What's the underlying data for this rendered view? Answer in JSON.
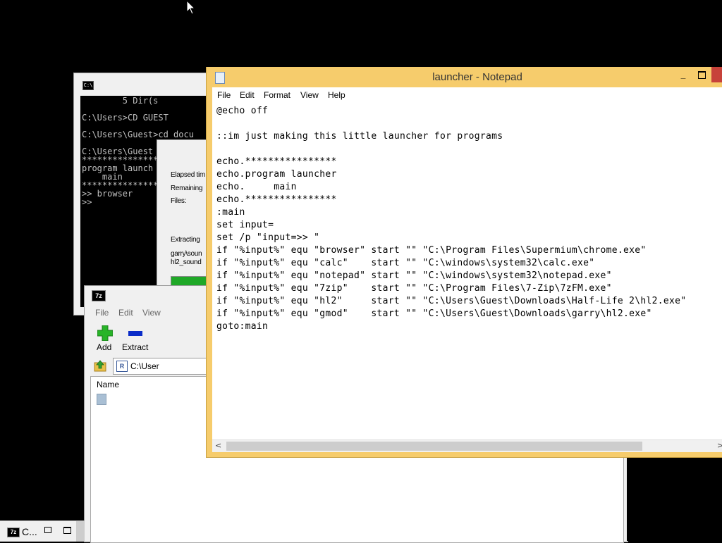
{
  "cmd": {
    "icon_text": "C:\\",
    "lines": [
      "        5 Dir(s",
      "C:\\Users>CD GUEST",
      "C:\\Users\\Guest>cd docu",
      "C:\\Users\\Guest",
      "*****************",
      "program launch",
      "    main",
      "*****************",
      ">> browser",
      ">>"
    ]
  },
  "extract": {
    "elapsed_label": "Elapsed tim",
    "remaining_label": "Remaining",
    "files_label": "Files:",
    "extracting_label": "Extracting",
    "file_line_1": "garry\\soun",
    "file_line_2": "hl2_sound",
    "progress_percent": 100,
    "bar_color": "#1fa827"
  },
  "sevenzip": {
    "icon_text": "7z",
    "menu": [
      "File",
      "Edit",
      "View"
    ],
    "toolbar": {
      "add_label": "Add",
      "extract_label": "Extract"
    },
    "path_value": "C:\\User",
    "column_name": "Name"
  },
  "notepad": {
    "title": "launcher - Notepad",
    "minimize_glyph": "_",
    "menu": [
      "File",
      "Edit",
      "Format",
      "View",
      "Help"
    ],
    "lines": [
      "@echo off",
      "",
      "::im just making this little launcher for programs",
      "",
      "echo.****************",
      "echo.program launcher",
      "echo.     main",
      "echo.****************",
      ":main",
      "set input=",
      "set /p \"input=>> \"",
      "if \"%input%\" equ \"browser\" start \"\" \"C:\\Program Files\\Supermium\\chrome.exe\"",
      "if \"%input%\" equ \"calc\"    start \"\" \"C:\\windows\\system32\\calc.exe\"",
      "if \"%input%\" equ \"notepad\" start \"\" \"C:\\windows\\system32\\notepad.exe\"",
      "if \"%input%\" equ \"7zip\"    start \"\" \"C:\\Program Files\\7-Zip\\7zFM.exe\"",
      "if \"%input%\" equ \"hl2\"     start \"\" \"C:\\Users\\Guest\\Downloads\\Half-Life 2\\hl2.exe\"",
      "if \"%input%\" equ \"gmod\"    start \"\" \"C:\\Users\\Guest\\Downloads\\garry\\hl2.exe\"",
      "goto:main"
    ],
    "scroll_left": "<",
    "scroll_right": ">",
    "accent_color": "#f6cc6c",
    "close_color": "#c7423a"
  },
  "minimized": {
    "icon_text": "7z",
    "label": "C..."
  }
}
